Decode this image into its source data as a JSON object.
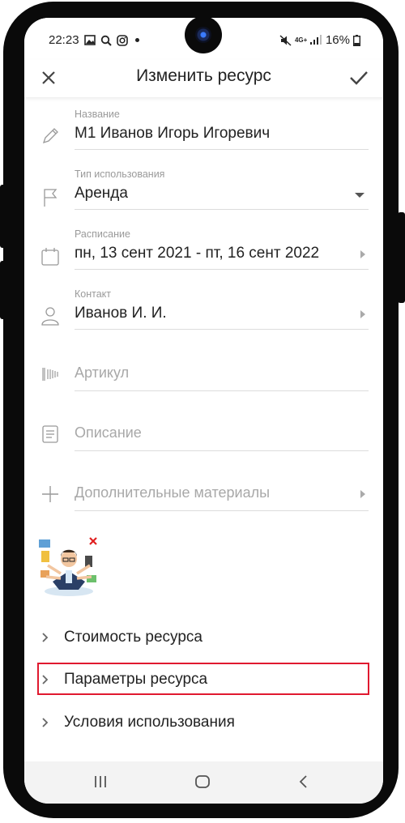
{
  "status": {
    "time": "22:23",
    "battery": "16%",
    "network": "4G+"
  },
  "appbar": {
    "title": "Изменить ресурс"
  },
  "fields": {
    "name": {
      "label": "Название",
      "value": "М1 Иванов Игорь Игоревич"
    },
    "usage_type": {
      "label": "Тип использования",
      "value": "Аренда"
    },
    "schedule": {
      "label": "Расписание",
      "value": "пн, 13 сент 2021 - пт, 16 сент 2022"
    },
    "contact": {
      "label": "Контакт",
      "value": "Иванов И. И."
    },
    "article": {
      "placeholder": "Артикул"
    },
    "description": {
      "placeholder": "Описание"
    },
    "materials": {
      "placeholder": "Дополнительные материалы"
    }
  },
  "sections": [
    {
      "label": "Стоимость ресурса"
    },
    {
      "label": "Параметры ресурса"
    },
    {
      "label": "Условия использования"
    }
  ],
  "colors": {
    "highlight": "#e0192f",
    "text": "#222222",
    "muted": "#a8a8a8"
  }
}
